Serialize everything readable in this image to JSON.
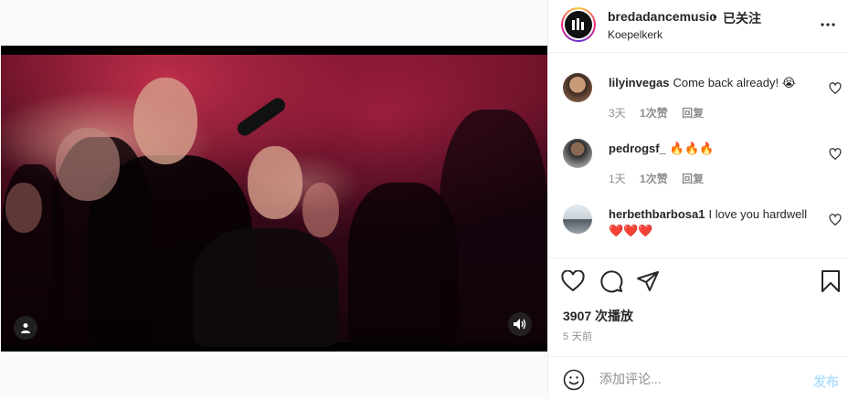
{
  "post": {
    "username": "bredadancemusic",
    "separator": "•",
    "follow_status": "已关注",
    "location": "Koepelkerk"
  },
  "comments": [
    {
      "user": "lilyinvegas",
      "text": "Come back already! 😭",
      "time": "3天",
      "likes": "1次赞",
      "reply": "回复"
    },
    {
      "user": "pedrogsf_",
      "text": "🔥🔥🔥",
      "time": "1天",
      "likes": "1次赞",
      "reply": "回复"
    },
    {
      "user": "herbethbarbosa1",
      "text": "I love you hardwell ❤️❤️❤️",
      "time": "",
      "likes": "",
      "reply": ""
    }
  ],
  "stats": {
    "views": "3907 次播放",
    "date": "5 天前"
  },
  "composer": {
    "placeholder": "添加评论...",
    "post_label": "发布"
  },
  "colors": {
    "link_disabled": "#b2dffc",
    "muted_text": "#8e8e8e",
    "border": "#efefef"
  },
  "icons": [
    "user-tag-icon",
    "sound-icon",
    "more-icon",
    "heart-icon",
    "comment-icon",
    "share-icon",
    "save-icon",
    "emoji-icon"
  ]
}
